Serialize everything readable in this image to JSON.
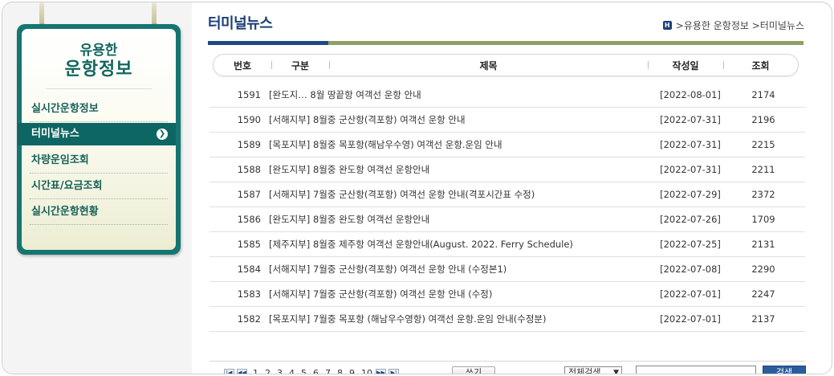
{
  "sidebar": {
    "title_top": "유용한",
    "title_main": "운항정보",
    "items": [
      {
        "label": "실시간운항정보"
      },
      {
        "label": "터미널뉴스",
        "arrow": "❯"
      },
      {
        "label": "차량운임조회"
      },
      {
        "label": "시간표/요금조회"
      },
      {
        "label": "실시간운항현황"
      }
    ]
  },
  "header": {
    "title": "터미널뉴스",
    "home_icon": "H",
    "breadcrumb": ">유용한 운항정보 >터미널뉴스"
  },
  "table": {
    "columns": [
      "번호",
      "구분",
      "제목",
      "작성일",
      "조회"
    ],
    "rows": [
      {
        "no": "1591",
        "title": "[완도지… 8월 땅끝항 여객선 운항 안내",
        "date": "[2022-08-01]",
        "views": "2174"
      },
      {
        "no": "1590",
        "title": "[서해지부] 8월중 군산항(격포항) 여객선 운항 안내",
        "date": "[2022-07-31]",
        "views": "2196"
      },
      {
        "no": "1589",
        "title": "[목포지부] 8월중 목포항(해남우수영) 여객선 운항.운임 안내",
        "date": "[2022-07-31]",
        "views": "2215"
      },
      {
        "no": "1588",
        "title": "[완도지부] 8월중 완도항 여객선 운항안내",
        "date": "[2022-07-31]",
        "views": "2211"
      },
      {
        "no": "1587",
        "title": "[서해지부] 7월중 군산항(격포항) 여객선 운항 안내(격포시간표 수정)",
        "date": "[2022-07-29]",
        "views": "2372"
      },
      {
        "no": "1586",
        "title": "[완도지부] 8월중 완도항 여객선 운항안내",
        "date": "[2022-07-26]",
        "views": "1709"
      },
      {
        "no": "1585",
        "title": "[제주지부] 8월중 제주항 여객선 운항안내(August. 2022. Ferry Schedule)",
        "date": "[2022-07-25]",
        "views": "2131"
      },
      {
        "no": "1584",
        "title": "[서해지부] 7월중 군산항(격포항) 여객선 운항 안내 (수정본1)",
        "date": "[2022-07-08]",
        "views": "2290"
      },
      {
        "no": "1583",
        "title": "[서해지부] 7월중 군산항(격포항) 여객선 운항 안내 (수정)",
        "date": "[2022-07-01]",
        "views": "2247"
      },
      {
        "no": "1582",
        "title": "[목포지부] 7월중 목포항 (해남우수영항) 여객선 운항.운임 안내(수정분)",
        "date": "[2022-07-01]",
        "views": "2137"
      }
    ]
  },
  "pager": {
    "first": "|◀",
    "prev": "◀◀",
    "pages": [
      "1",
      "2",
      "3",
      "4",
      "5",
      "6",
      "7",
      "8",
      "9",
      "10"
    ],
    "next": "▶▶",
    "last": "▶|",
    "write_label": "쓰기",
    "search_select": "전체검색",
    "search_button": "검색"
  }
}
